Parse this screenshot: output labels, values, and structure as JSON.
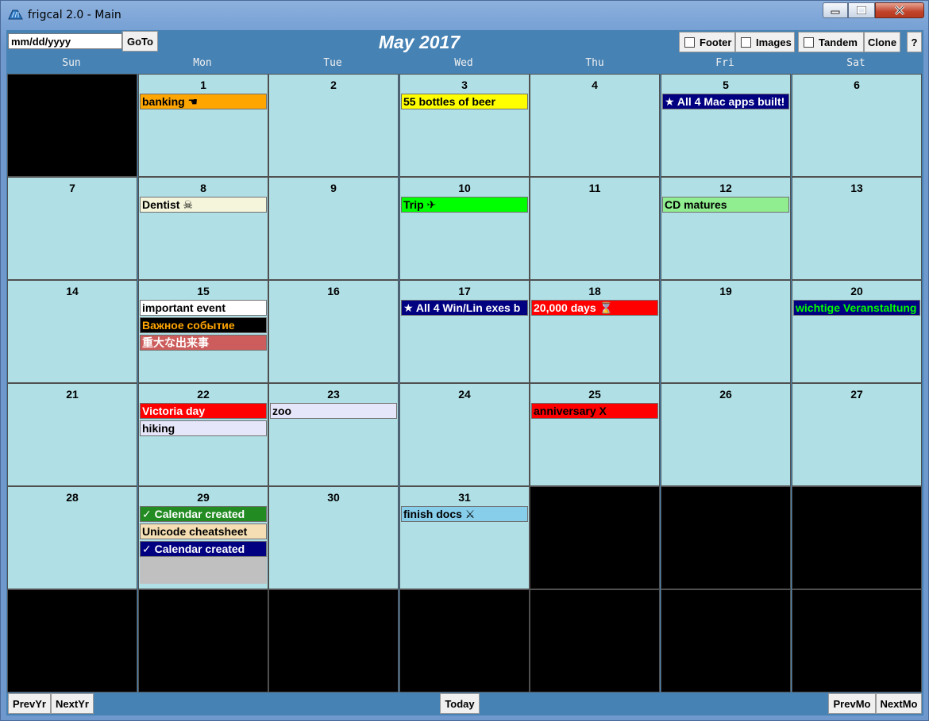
{
  "window": {
    "title": "frigcal 2.0 - Main"
  },
  "toolbar": {
    "date_placeholder": "mm/dd/yyyy",
    "goto_label": "GoTo",
    "month_title": "May 2017",
    "footer_label": "Footer",
    "images_label": "Images",
    "tandem_label": "Tandem",
    "clone_label": "Clone",
    "help_label": "?"
  },
  "weekdays": [
    "Sun",
    "Mon",
    "Tue",
    "Wed",
    "Thu",
    "Fri",
    "Sat"
  ],
  "colors": {
    "cell_bg": "#b0e0e6",
    "blank_bg": "#000000",
    "client_bg": "#4682b4"
  },
  "weeks": [
    [
      {
        "day": "",
        "events": []
      },
      {
        "day": "1",
        "events": [
          {
            "text": "banking ☚",
            "bg": "#ffa500",
            "fg": "#000000"
          }
        ]
      },
      {
        "day": "2",
        "events": []
      },
      {
        "day": "3",
        "events": [
          {
            "text": "55 bottles of beer",
            "bg": "#ffff00",
            "fg": "#000000"
          }
        ]
      },
      {
        "day": "4",
        "events": []
      },
      {
        "day": "5",
        "events": [
          {
            "text": "★ All 4 Mac apps built!",
            "bg": "#000080",
            "fg": "#ffffff"
          }
        ]
      },
      {
        "day": "6",
        "events": []
      }
    ],
    [
      {
        "day": "7",
        "events": []
      },
      {
        "day": "8",
        "events": [
          {
            "text": "Dentist ☠",
            "bg": "#f5f5dc",
            "fg": "#000000"
          }
        ]
      },
      {
        "day": "9",
        "events": []
      },
      {
        "day": "10",
        "events": [
          {
            "text": "Trip ✈",
            "bg": "#00ff00",
            "fg": "#000000"
          }
        ]
      },
      {
        "day": "11",
        "events": []
      },
      {
        "day": "12",
        "events": [
          {
            "text": "CD matures",
            "bg": "#90ee90",
            "fg": "#000000"
          }
        ]
      },
      {
        "day": "13",
        "events": []
      }
    ],
    [
      {
        "day": "14",
        "events": []
      },
      {
        "day": "15",
        "events": [
          {
            "text": "important event",
            "bg": "#ffffff",
            "fg": "#000000"
          },
          {
            "text": "Важное событие",
            "bg": "#000000",
            "fg": "#ffa500"
          },
          {
            "text": "重大な出来事",
            "bg": "#cd5c5c",
            "fg": "#ffffff"
          }
        ]
      },
      {
        "day": "16",
        "events": []
      },
      {
        "day": "17",
        "events": [
          {
            "text": "★ All 4 Win/Lin exes b",
            "bg": "#000080",
            "fg": "#ffffff"
          }
        ]
      },
      {
        "day": "18",
        "events": [
          {
            "text": "20,000 days ⌛",
            "bg": "#ff0000",
            "fg": "#ffffff"
          }
        ]
      },
      {
        "day": "19",
        "events": []
      },
      {
        "day": "20",
        "events": [
          {
            "text": "wichtige Veranstaltung",
            "bg": "#000080",
            "fg": "#00ff00"
          }
        ]
      }
    ],
    [
      {
        "day": "21",
        "events": []
      },
      {
        "day": "22",
        "events": [
          {
            "text": "Victoria day",
            "bg": "#ff0000",
            "fg": "#ffffff"
          },
          {
            "text": "hiking",
            "bg": "#e6e6fa",
            "fg": "#000000"
          }
        ]
      },
      {
        "day": "23",
        "events": [
          {
            "text": "zoo",
            "bg": "#e6e6fa",
            "fg": "#000000"
          }
        ]
      },
      {
        "day": "24",
        "events": []
      },
      {
        "day": "25",
        "events": [
          {
            "text": "anniversary X",
            "bg": "#ff0000",
            "fg": "#000000"
          }
        ]
      },
      {
        "day": "26",
        "events": []
      },
      {
        "day": "27",
        "events": []
      }
    ],
    [
      {
        "day": "28",
        "events": []
      },
      {
        "day": "29",
        "events": [
          {
            "text": "✓ Calendar created",
            "bg": "#228b22",
            "fg": "#ffffff"
          },
          {
            "text": "Unicode cheatsheet",
            "bg": "#f5deb3",
            "fg": "#000000"
          },
          {
            "text": "✓ Calendar created",
            "bg": "#000080",
            "fg": "#ffffff"
          }
        ],
        "overflow": true
      },
      {
        "day": "30",
        "events": []
      },
      {
        "day": "31",
        "events": [
          {
            "text": "finish docs ⚔",
            "bg": "#87ceeb",
            "fg": "#000000"
          }
        ]
      },
      {
        "day": "",
        "events": []
      },
      {
        "day": "",
        "events": []
      },
      {
        "day": "",
        "events": []
      }
    ],
    [
      {
        "day": "",
        "events": []
      },
      {
        "day": "",
        "events": []
      },
      {
        "day": "",
        "events": []
      },
      {
        "day": "",
        "events": []
      },
      {
        "day": "",
        "events": []
      },
      {
        "day": "",
        "events": []
      },
      {
        "day": "",
        "events": []
      }
    ]
  ],
  "bottombar": {
    "prevyr_label": "PrevYr",
    "nextyr_label": "NextYr",
    "today_label": "Today",
    "prevmo_label": "PrevMo",
    "nextmo_label": "NextMo"
  }
}
